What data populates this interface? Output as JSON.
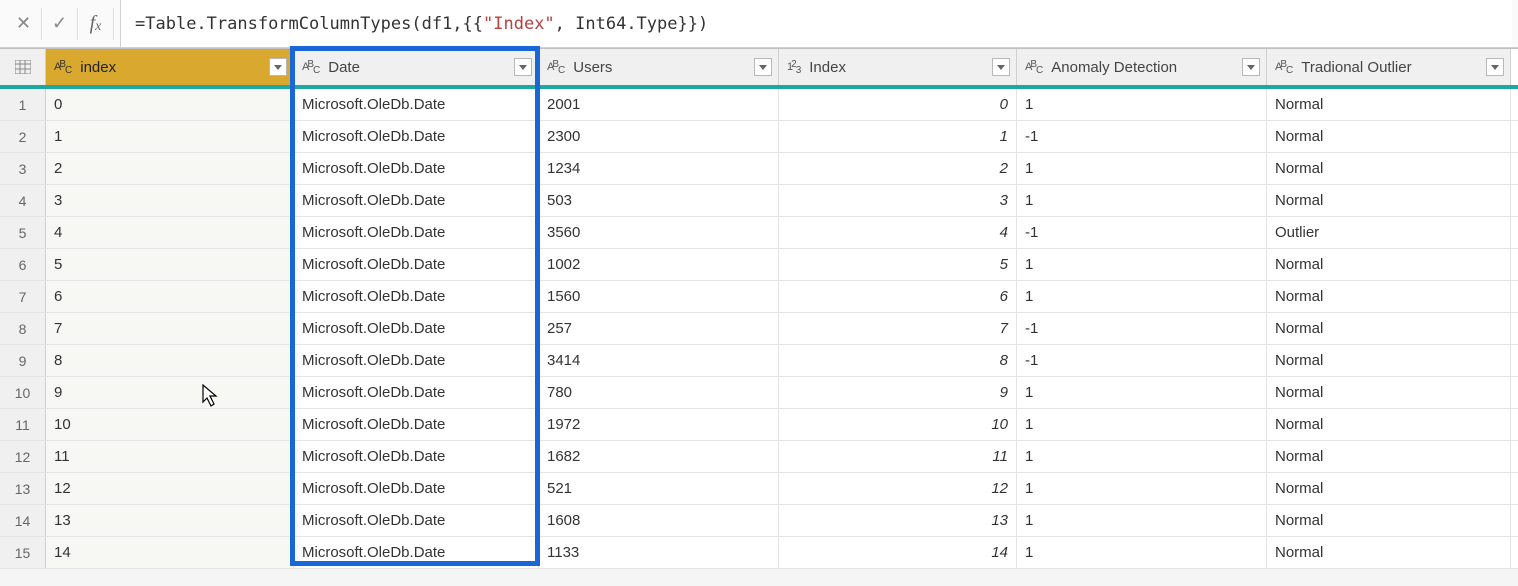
{
  "formula": {
    "prefix": "= ",
    "fn": "Table.TransformColumnTypes",
    "open": "(df1,{{",
    "str": "\"Index\"",
    "rest": ", Int64.Type}})"
  },
  "columns": [
    {
      "label": "index",
      "type": "abc",
      "selected": true
    },
    {
      "label": "Date",
      "type": "abc",
      "selected": false
    },
    {
      "label": "Users",
      "type": "abc",
      "selected": false
    },
    {
      "label": "Index",
      "type": "123",
      "selected": false
    },
    {
      "label": "Anomaly Detection",
      "type": "abc",
      "selected": false
    },
    {
      "label": "Tradional Outlier",
      "type": "abc",
      "selected": false
    }
  ],
  "rows": [
    {
      "n": "1",
      "index": "0",
      "date": "Microsoft.OleDb.Date",
      "users": "2001",
      "idx": "0",
      "anom": "1",
      "out": "Normal"
    },
    {
      "n": "2",
      "index": "1",
      "date": "Microsoft.OleDb.Date",
      "users": "2300",
      "idx": "1",
      "anom": "-1",
      "out": "Normal"
    },
    {
      "n": "3",
      "index": "2",
      "date": "Microsoft.OleDb.Date",
      "users": "1234",
      "idx": "2",
      "anom": "1",
      "out": "Normal"
    },
    {
      "n": "4",
      "index": "3",
      "date": "Microsoft.OleDb.Date",
      "users": "503",
      "idx": "3",
      "anom": "1",
      "out": "Normal"
    },
    {
      "n": "5",
      "index": "4",
      "date": "Microsoft.OleDb.Date",
      "users": "3560",
      "idx": "4",
      "anom": "-1",
      "out": "Outlier"
    },
    {
      "n": "6",
      "index": "5",
      "date": "Microsoft.OleDb.Date",
      "users": "1002",
      "idx": "5",
      "anom": "1",
      "out": "Normal"
    },
    {
      "n": "7",
      "index": "6",
      "date": "Microsoft.OleDb.Date",
      "users": "1560",
      "idx": "6",
      "anom": "1",
      "out": "Normal"
    },
    {
      "n": "8",
      "index": "7",
      "date": "Microsoft.OleDb.Date",
      "users": "257",
      "idx": "7",
      "anom": "-1",
      "out": "Normal"
    },
    {
      "n": "9",
      "index": "8",
      "date": "Microsoft.OleDb.Date",
      "users": "3414",
      "idx": "8",
      "anom": "-1",
      "out": "Normal"
    },
    {
      "n": "10",
      "index": "9",
      "date": "Microsoft.OleDb.Date",
      "users": "780",
      "idx": "9",
      "anom": "1",
      "out": "Normal"
    },
    {
      "n": "11",
      "index": "10",
      "date": "Microsoft.OleDb.Date",
      "users": "1972",
      "idx": "10",
      "anom": "1",
      "out": "Normal"
    },
    {
      "n": "12",
      "index": "11",
      "date": "Microsoft.OleDb.Date",
      "users": "1682",
      "idx": "11",
      "anom": "1",
      "out": "Normal"
    },
    {
      "n": "13",
      "index": "12",
      "date": "Microsoft.OleDb.Date",
      "users": "521",
      "idx": "12",
      "anom": "1",
      "out": "Normal"
    },
    {
      "n": "14",
      "index": "13",
      "date": "Microsoft.OleDb.Date",
      "users": "1608",
      "idx": "13",
      "anom": "1",
      "out": "Normal"
    },
    {
      "n": "15",
      "index": "14",
      "date": "Microsoft.OleDb.Date",
      "users": "1133",
      "idx": "14",
      "anom": "1",
      "out": "Normal"
    }
  ]
}
